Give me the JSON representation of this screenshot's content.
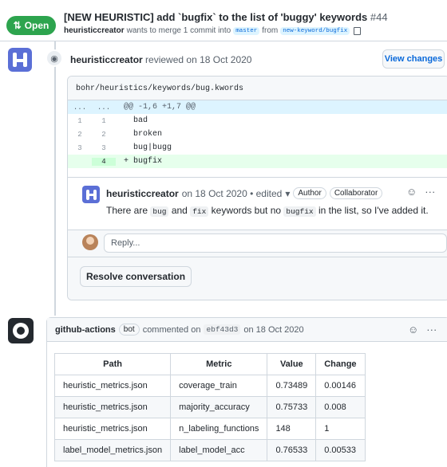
{
  "header": {
    "state": "Open",
    "title": "[NEW HEURISTIC] add `bugfix` to the list of 'buggy' keywords",
    "number": "#44",
    "author": "heuristiccreator",
    "merge_text": "wants to merge 1 commit into",
    "base_branch": "master",
    "from_text": "from",
    "head_branch": "new-keyword/bugfix"
  },
  "review": {
    "author": "heuristiccreator",
    "action": "reviewed on 18 Oct 2020",
    "view_changes": "View changes",
    "file_path": "bohr/heuristics/keywords/bug.kwords",
    "diff": [
      {
        "old": "...",
        "new": "...",
        "code": "@@ -1,6 +1,7 @@",
        "type": "hunk"
      },
      {
        "old": "1",
        "new": "1",
        "code": "  bad",
        "type": "ctx"
      },
      {
        "old": "2",
        "new": "2",
        "code": "  broken",
        "type": "ctx"
      },
      {
        "old": "3",
        "new": "3",
        "code": "  bug|bugg",
        "type": "ctx"
      },
      {
        "old": "",
        "new": "4",
        "code": "+ bugfix",
        "type": "add"
      }
    ],
    "comment": {
      "author": "heuristiccreator",
      "meta": "on 18 Oct 2020 • edited",
      "labels": [
        "Author",
        "Collaborator"
      ],
      "body_pre": "There are",
      "code1": "bug",
      "and": "and",
      "code2": "fix",
      "body_mid": "keywords but no",
      "code3": "bugfix",
      "body_post": "in the list, so I've added it."
    },
    "reply_placeholder": "Reply...",
    "resolve_label": "Resolve conversation"
  },
  "actions_comment": {
    "author": "github-actions",
    "bot_label": "bot",
    "action": "commented on",
    "commit": "ebf43d3",
    "date": "on 18 Oct 2020",
    "table": {
      "headers": [
        "Path",
        "Metric",
        "Value",
        "Change"
      ],
      "rows": [
        [
          "heuristic_metrics.json",
          "coverage_train",
          "0.73489",
          "0.00146"
        ],
        [
          "heuristic_metrics.json",
          "majority_accuracy",
          "0.75733",
          "0.008"
        ],
        [
          "heuristic_metrics.json",
          "n_labeling_functions",
          "148",
          "1"
        ],
        [
          "label_model_metrics.json",
          "label_model_acc",
          "0.76533",
          "0.00533"
        ]
      ]
    }
  }
}
